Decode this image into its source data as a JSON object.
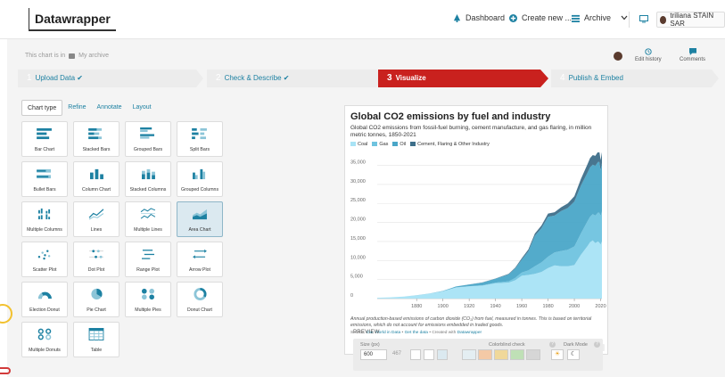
{
  "app": {
    "logo": "Datawrapper",
    "nav": {
      "dashboard": "Dashboard",
      "create": "Create new ...",
      "archive": "Archive"
    },
    "user": "triliana STAIN SAR"
  },
  "breadcrumb": {
    "prefix": "This chart is in",
    "folder": "My archive"
  },
  "actions": {
    "edit_history": "Edit history",
    "comments": "Comments"
  },
  "steps": [
    {
      "num": "1",
      "label": "Upload Data ✔",
      "state": "done"
    },
    {
      "num": "2",
      "label": "Check & Describe ✔",
      "state": "done"
    },
    {
      "num": "3",
      "label": "Visualize",
      "state": "active"
    },
    {
      "num": "4",
      "label": "Publish & Embed",
      "state": "future"
    }
  ],
  "tabs": [
    "Chart type",
    "Refine",
    "Annotate",
    "Layout"
  ],
  "chart_types": [
    {
      "label": "Bar Chart",
      "icon": "bar-chart-icon"
    },
    {
      "label": "Stacked Bars",
      "icon": "stacked-bars-icon"
    },
    {
      "label": "Grouped Bars",
      "icon": "grouped-bars-icon"
    },
    {
      "label": "Split Bars",
      "icon": "split-bars-icon"
    },
    {
      "label": "Bullet Bars",
      "icon": "bullet-bars-icon"
    },
    {
      "label": "Column Chart",
      "icon": "column-chart-icon"
    },
    {
      "label": "Stacked Columns",
      "icon": "stacked-columns-icon"
    },
    {
      "label": "Grouped Columns",
      "icon": "grouped-columns-icon"
    },
    {
      "label": "Multiple Columns",
      "icon": "multiple-columns-icon"
    },
    {
      "label": "Lines",
      "icon": "lines-icon"
    },
    {
      "label": "Multiple Lines",
      "icon": "multiple-lines-icon"
    },
    {
      "label": "Area Chart",
      "icon": "area-chart-icon",
      "selected": true
    },
    {
      "label": "Scatter Plot",
      "icon": "scatter-plot-icon"
    },
    {
      "label": "Dot Plot",
      "icon": "dot-plot-icon"
    },
    {
      "label": "Range Plot",
      "icon": "range-plot-icon"
    },
    {
      "label": "Arrow Plot",
      "icon": "arrow-plot-icon"
    },
    {
      "label": "Election Donut",
      "icon": "election-donut-icon"
    },
    {
      "label": "Pie Chart",
      "icon": "pie-chart-icon"
    },
    {
      "label": "Multiple Pies",
      "icon": "multiple-pies-icon"
    },
    {
      "label": "Donut Chart",
      "icon": "donut-chart-icon"
    },
    {
      "label": "Multiple Donuts",
      "icon": "multiple-donuts-icon"
    },
    {
      "label": "Table",
      "icon": "table-icon"
    }
  ],
  "chart_card": {
    "title": "Global CO2 emissions by fuel and industry",
    "subtitle": "Global CO2 emissions from fossil-fuel burning, cement manufacture, and gas flaring, in million metric tonnes, 1850-2021",
    "note": "Annual production-based emissions of carbon dioxide (CO₂) from fuel, measured in tonnes. This is based on territorial emissions, which do not account for emissions embedded in traded goods.",
    "source_prefix": "Source:",
    "source": "Our World in Data",
    "source_sep1": "•",
    "get_data": "Get the data",
    "source_sep2": "• Created with",
    "created_with": "Datawrapper"
  },
  "chart_data": {
    "type": "area",
    "title": "Global CO2 emissions by fuel and industry",
    "legend": [
      "Coal",
      "Gas",
      "Oil",
      "Cement, Flaring & Other Industry"
    ],
    "colors": [
      "#a8e3f5",
      "#6fc3df",
      "#4aa6c8",
      "#3e6f8a"
    ],
    "x": [
      1850,
      1860,
      1870,
      1880,
      1890,
      1900,
      1910,
      1920,
      1930,
      1940,
      1950,
      1955,
      1960,
      1965,
      1970,
      1975,
      1980,
      1985,
      1990,
      1995,
      2000,
      2005,
      2010,
      2012,
      2014,
      2016,
      2018,
      2019,
      2020,
      2021
    ],
    "series": [
      {
        "name": "Coal",
        "values": [
          200,
          330,
          520,
          850,
          1300,
          1900,
          2900,
          3200,
          3400,
          4000,
          4200,
          4800,
          6000,
          6200,
          6500,
          7000,
          8000,
          8700,
          8500,
          8500,
          8800,
          11500,
          13800,
          14800,
          15300,
          14600,
          15000,
          14700,
          14200,
          15000
        ]
      },
      {
        "name": "Gas",
        "values": [
          0,
          0,
          0,
          0,
          5,
          20,
          40,
          60,
          100,
          200,
          350,
          600,
          850,
          1200,
          2000,
          2500,
          3000,
          3400,
          4000,
          4300,
          4900,
          5600,
          6500,
          6700,
          6900,
          7200,
          7600,
          7800,
          7500,
          7900
        ]
      },
      {
        "name": "Oil",
        "values": [
          0,
          0,
          5,
          20,
          50,
          100,
          250,
          450,
          700,
          1000,
          1800,
          2500,
          3400,
          5000,
          8000,
          9000,
          10500,
          9700,
          10500,
          11000,
          11800,
          12600,
          12800,
          13000,
          13000,
          13100,
          13300,
          13400,
          12000,
          12700
        ]
      },
      {
        "name": "Cement, Flaring & Other Industry",
        "values": [
          0,
          0,
          0,
          0,
          0,
          0,
          0,
          20,
          40,
          60,
          150,
          200,
          350,
          500,
          600,
          700,
          850,
          900,
          1000,
          1200,
          1400,
          1700,
          2200,
          2400,
          2500,
          2600,
          2700,
          2800,
          2700,
          2900
        ]
      }
    ],
    "xticks": [
      1880,
      1900,
      1920,
      1940,
      1960,
      1980,
      2000,
      2020
    ],
    "yticks": [
      "0",
      "5,000",
      "10,000",
      "15,000",
      "20,000",
      "25,000",
      "30,000",
      "35,000"
    ],
    "xlim": [
      1850,
      2021
    ],
    "ylim": [
      0,
      37000
    ]
  },
  "preview": {
    "label": "PREVIEW",
    "size_label": "Size (px)",
    "width": "600",
    "height": "467",
    "colorblind_label": "Colorblind check",
    "darkmode_label": "Dark Mode",
    "help_glyph": "?",
    "sun_glyph": "☀",
    "moon_glyph": "☾"
  }
}
